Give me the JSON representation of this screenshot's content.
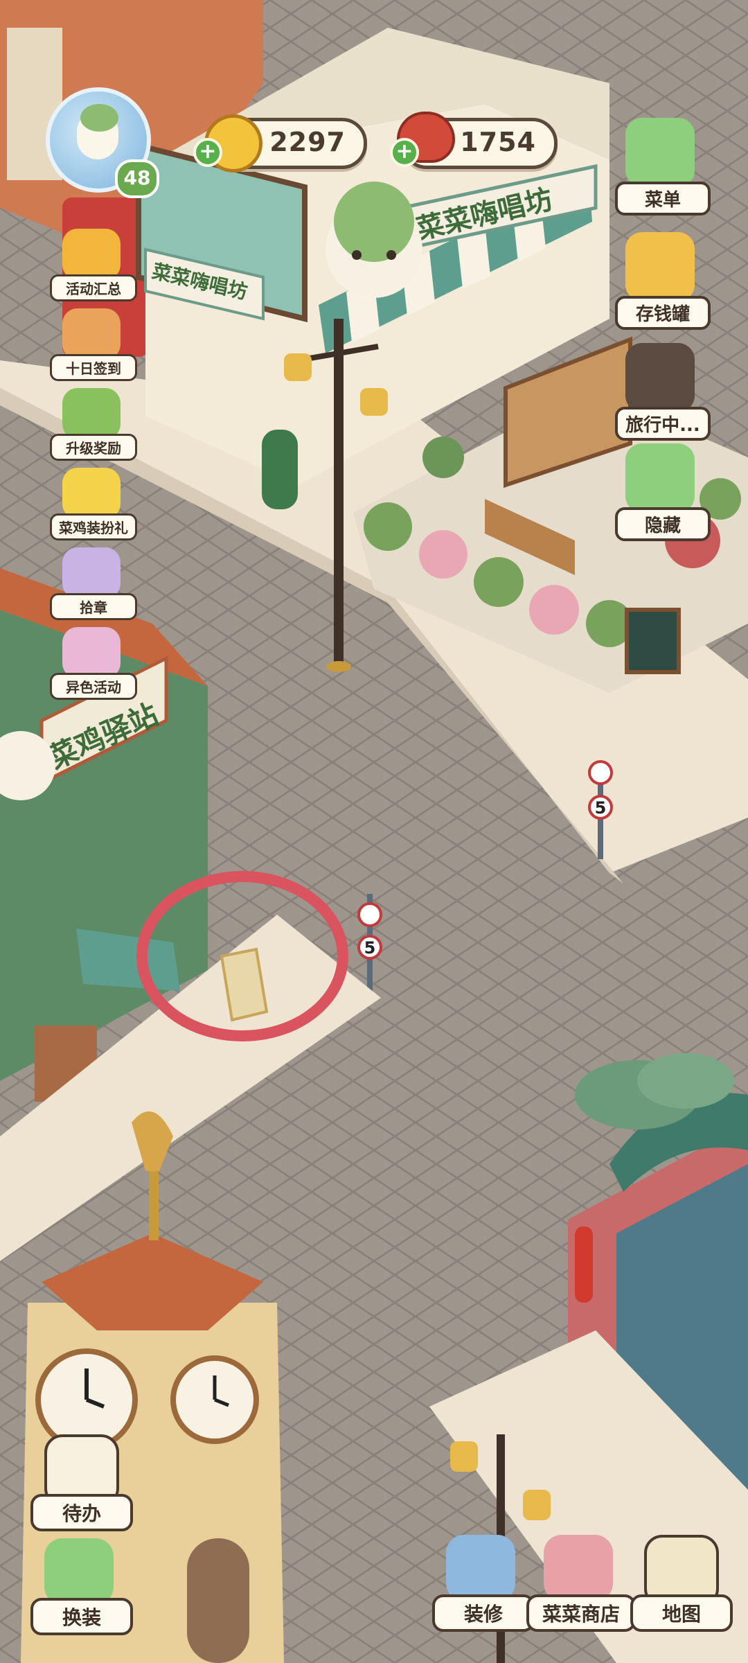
{
  "player": {
    "level": "48"
  },
  "currency": {
    "coins": "2297",
    "food": "1754"
  },
  "left_menu": [
    {
      "label": "活动汇总"
    },
    {
      "label": "十日签到"
    },
    {
      "label": "升级奖励"
    },
    {
      "label": "菜鸡装扮礼"
    },
    {
      "label": "拾章"
    },
    {
      "label": "异色活动"
    }
  ],
  "right_menu": [
    {
      "label": "菜单"
    },
    {
      "label": "存钱罐"
    },
    {
      "label": "旅行中..."
    },
    {
      "label": "隐藏"
    }
  ],
  "bottom_left": [
    {
      "label": "待办"
    },
    {
      "label": "换装"
    }
  ],
  "bottom_right": [
    {
      "label": "装修"
    },
    {
      "label": "菜菜商店"
    },
    {
      "label": "地图"
    }
  ],
  "scene": {
    "shop_sign_1": "菜菜嗨唱坊",
    "shop_sign_2": "菜菜嗨唱坊",
    "station_sign": "菜鸡驿站",
    "speed_limit_1": "5",
    "speed_limit_2": "5"
  },
  "colors": {
    "annotation_circle": "#d9545f",
    "accent_green": "#58b04a"
  }
}
